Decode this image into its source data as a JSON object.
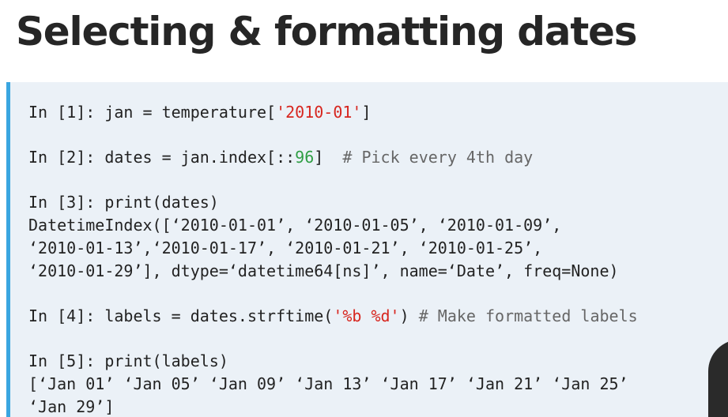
{
  "title": "Selecting & formatting dates",
  "cells": [
    {
      "prompt": "In [1]: ",
      "code": "jan = temperature[",
      "string": "'2010-01'",
      "code_end": "]"
    },
    {
      "prompt": "In [2]: ",
      "code": "dates = jan.index[::",
      "number": "96",
      "code_end": "]  ",
      "comment": "# Pick every 4th day"
    },
    {
      "prompt": "In [3]: ",
      "code": "print(dates)",
      "output": [
        "DatetimeIndex([‘2010-01-01’, ‘2010-01-05’, ‘2010-01-09’,",
        "‘2010-01-13’,‘2010-01-17’, ‘2010-01-21’, ‘2010-01-25’,",
        "‘2010-01-29’], dtype=‘datetime64[ns]’, name=‘Date’, freq=None)"
      ]
    },
    {
      "prompt": "In [4]: ",
      "code": "labels = dates.strftime(",
      "string": "'%b %d'",
      "code_end": ") ",
      "comment": "# Make formatted labels"
    },
    {
      "prompt": "In [5]: ",
      "code": "print(labels)",
      "output": [
        "[‘Jan 01’ ‘Jan 05’ ‘Jan 09’ ‘Jan 13’ ‘Jan 17’ ‘Jan 21’ ‘Jan 25’",
        "‘Jan 29’]"
      ]
    }
  ],
  "colors": {
    "panel_background": "#ebf1f7",
    "panel_accent": "#3aa6e0",
    "string": "#d7261f",
    "number": "#2f9e44",
    "comment": "#666666"
  }
}
